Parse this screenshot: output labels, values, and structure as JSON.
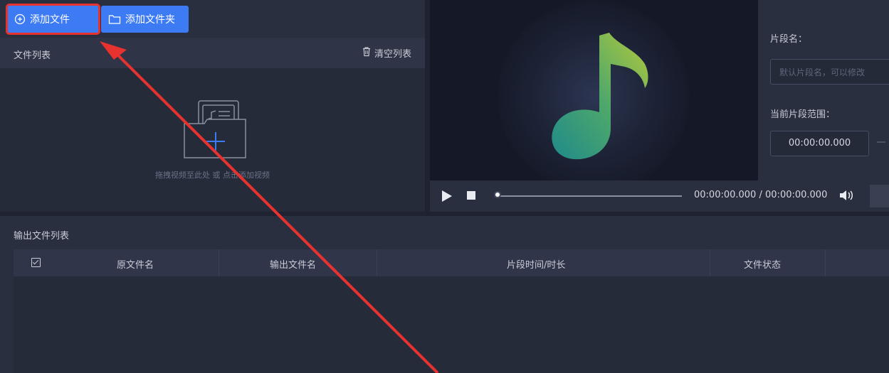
{
  "toolbar": {
    "add_file_label": "添加文件",
    "add_folder_label": "添加文件夹"
  },
  "file_list": {
    "title": "文件列表",
    "clear_label": "清空列表",
    "empty_hint": "拖拽视频至此处 或 点击添加视频"
  },
  "preview": {
    "segment_name_label": "片段名：",
    "segment_name_placeholder": "默认片段名，可以修改",
    "current_range_label": "当前片段范围：",
    "range_start_value": "00:00:00.000",
    "range_dash": "—",
    "current_time": "00:00:00.000",
    "time_separator": "/",
    "total_time": "00:00:00.000",
    "progress": 0
  },
  "output": {
    "title": "输出文件列表",
    "columns": [
      "原文件名",
      "输出文件名",
      "片段时间/时长",
      "文件状态"
    ]
  },
  "colors": {
    "accent": "#3d7bf5",
    "highlight": "#e8322f"
  }
}
